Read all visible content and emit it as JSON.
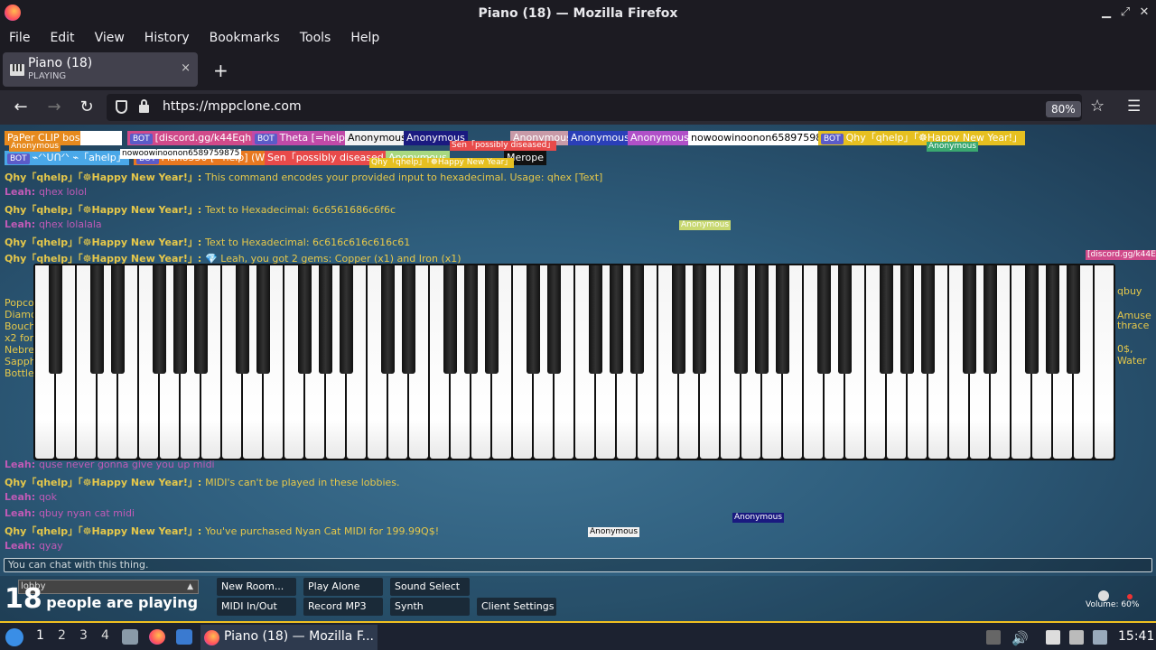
{
  "window": {
    "title": "Piano (18) — Mozilla Firefox"
  },
  "menu": [
    "File",
    "Edit",
    "View",
    "History",
    "Bookmarks",
    "Tools",
    "Help"
  ],
  "tab": {
    "title": "Piano (18)",
    "subtitle": "PLAYING",
    "close": "×",
    "new": "+"
  },
  "nav": {
    "url": "https://mppclone.com",
    "zoom": "80%"
  },
  "participants": [
    {
      "label": "PaPer CLIP boss",
      "bg": "#e68a1e",
      "fg": "#fff"
    },
    {
      "label": "",
      "bg": "#ffffff",
      "fg": "#000"
    },
    {
      "label": "[discord.gg/k44Eqha]",
      "bg": "#d04a8a",
      "fg": "#fff",
      "bot": "BOT"
    },
    {
      "label": "Theta [=help]",
      "bg": "#c04aa8",
      "fg": "#fff",
      "bot": "BOT"
    },
    {
      "label": "Anonymous",
      "bg": "#f2f2f2",
      "fg": "#000"
    },
    {
      "label": "Anonymous",
      "bg": "#1a1a80",
      "fg": "#fff"
    },
    {
      "label": "Anonymous",
      "bg": "#c89aa8",
      "fg": "#fff"
    },
    {
      "label": "Anonymous",
      "bg": "#2a3fb8",
      "fg": "#fff"
    },
    {
      "label": "Anonymous",
      "bg": "#b050c8",
      "fg": "#fff"
    },
    {
      "label": "nowoowinoonon6589759875",
      "bg": "#ffffff",
      "fg": "#000"
    },
    {
      "label": "Qhy「qhelp」「☸Happy New Year!」",
      "bg": "#e6c020",
      "fg": "#fff",
      "bot": "BOT"
    },
    {
      "label": "⌁ᐟᐠᑌᑎᐟᐠ ⌁「aheIp」",
      "bg": "#4aa8e8",
      "fg": "#fff",
      "bot": "BOT"
    },
    {
      "label": "Piano550 [=help] (WIP)",
      "bg": "#e87820",
      "fg": "#fff",
      "bot": "BOT"
    },
    {
      "label": "Sen「possibly diseased」",
      "bg": "#e84a4a",
      "fg": "#fff"
    },
    {
      "label": "Anonymous",
      "bg": "#a8d880",
      "fg": "#fff"
    },
    {
      "label": "Merope",
      "bg": "#111111",
      "fg": "#fff"
    }
  ],
  "mini_tags": [
    {
      "label": "Anonymous",
      "bg": "#e68a1e",
      "fg": "#fff"
    },
    {
      "label": "nowoowinoonon6589759875",
      "bg": "#ffffff",
      "fg": "#000"
    },
    {
      "label": "Sen「possibly diseased」",
      "bg": "#e84a4a",
      "fg": "#fff"
    },
    {
      "label": "Anonymous",
      "bg": "#3aa870",
      "fg": "#fff"
    },
    {
      "label": "Qhy「qhelp」「☸Happy New Year」",
      "bg": "#e6c020",
      "fg": "#fff"
    },
    {
      "label": "Anonymous",
      "bg": "#c8d870",
      "fg": "#fff"
    },
    {
      "label": "[discord.gg/k44Eqh",
      "bg": "#d04a8a",
      "fg": "#fff"
    },
    {
      "label": "⌁ᐟᐠᑌᑎᐟᐠ ⌁「aheIp」",
      "bg": "#a8d8f0",
      "fg": "#fff"
    },
    {
      "label": "Anonymous",
      "bg": "#b050c8",
      "fg": "#fff"
    },
    {
      "label": "Anonymous",
      "bg": "#1a1a80",
      "fg": "#fff"
    },
    {
      "label": "Anonymous",
      "bg": "#f2f2f2",
      "fg": "#000"
    }
  ],
  "chat": [
    {
      "name": "Qhy「qhelp」「☸Happy New Year!」:",
      "msg": "This command encodes your provided input to hexadecimal. Usage: qhex [Text]",
      "type": "bot"
    },
    {
      "name": "Leah:",
      "msg": "qhex lolol",
      "type": "user"
    },
    {
      "name": "Qhy「qhelp」「☸Happy New Year!」:",
      "msg": "Text to Hexadecimal: 6c6561686c6f6c",
      "type": "bot"
    },
    {
      "name": "Leah:",
      "msg": "qhex lolalala",
      "type": "user"
    },
    {
      "name": "Qhy「qhelp」「☸Happy New Year!」:",
      "msg": "Text to Hexadecimal: 6c616c616c616c61",
      "type": "bot"
    },
    {
      "name": "Qhy「qhelp」「☸Happy New Year!」:",
      "msg": "💎 Leah, you got 2 gems: Copper (x1) and Iron (x1)",
      "type": "bot"
    }
  ],
  "chat_bottom": [
    {
      "name": "Leah:",
      "msg": "quse never gonna give you up midi",
      "type": "user"
    },
    {
      "name": "Qhy「qhelp」「☸Happy New Year!」:",
      "msg": "MIDI's can't be played in these lobbies.",
      "type": "bot"
    },
    {
      "name": "Leah:",
      "msg": "qok",
      "type": "user"
    },
    {
      "name": "Leah:",
      "msg": "qbuy nyan cat midi",
      "type": "user"
    },
    {
      "name": "Qhy「qhelp」「☸Happy New Year!」:",
      "msg": "You've purchased Nyan Cat MIDI for 199.99Q$!",
      "type": "bot"
    },
    {
      "name": "Leah:",
      "msg": "qyay",
      "type": "user"
    }
  ],
  "side_text_left": [
    "Popco",
    "Diamo",
    "Bouch",
    "x2 for",
    "Nebre",
    "Sapph",
    "Bottle"
  ],
  "side_text_right": [
    "qbuy",
    "Amuse",
    "thrace",
    "0$,",
    "Water"
  ],
  "chat_input": {
    "placeholder": "You can chat with this thing."
  },
  "footer": {
    "room": "lobby",
    "count": "18",
    "count_text": "people are playing",
    "buttons": [
      "New Room...",
      "Play Alone",
      "Sound Select",
      "MIDI In/Out",
      "Record MP3",
      "Synth",
      "Client Settings"
    ],
    "volume": "Volume: 60%"
  },
  "taskbar": {
    "workspaces": [
      "1",
      "2",
      "3",
      "4"
    ],
    "task": "Piano (18) — Mozilla F...",
    "clock": "15:41"
  }
}
